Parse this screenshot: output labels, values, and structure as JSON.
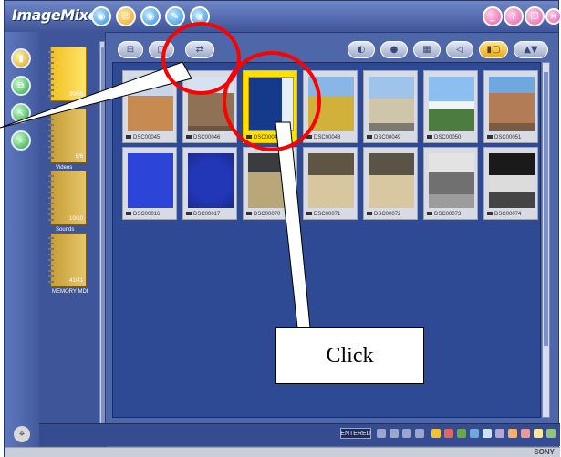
{
  "app": {
    "title": "ImageMixer",
    "title_buttons": [
      {
        "icon": "disc-blue-icon"
      },
      {
        "icon": "person-orange-icon"
      },
      {
        "icon": "disc-blue-icon"
      },
      {
        "icon": "edit-blue-icon"
      },
      {
        "icon": "disc-blue-icon"
      }
    ],
    "window_controls": [
      {
        "icon": "minimize-icon",
        "glyph": "_"
      },
      {
        "icon": "help-icon",
        "glyph": "?"
      },
      {
        "icon": "restore-icon",
        "glyph": "❐"
      },
      {
        "icon": "close-icon",
        "glyph": "✕"
      }
    ]
  },
  "left_buttons": [
    {
      "icon": "album-icon"
    },
    {
      "icon": "copy-icon"
    },
    {
      "icon": "cursor-icon"
    },
    {
      "icon": "search-icon"
    }
  ],
  "albums": [
    {
      "label": "",
      "count": "30/55",
      "selected": true
    },
    {
      "label": "Videos",
      "count": "6/6",
      "selected": false
    },
    {
      "label": "Sounds",
      "count": "10/10",
      "selected": false
    },
    {
      "label": "MEMORY MDI",
      "count": "41/41",
      "selected": false
    }
  ],
  "toolbar_left": [
    {
      "glyph": "⊟"
    },
    {
      "glyph": "▢"
    },
    {
      "glyph": "⇄"
    }
  ],
  "toolbar_right": [
    {
      "glyph": "◐"
    },
    {
      "glyph": "●"
    },
    {
      "glyph": "▦"
    },
    {
      "glyph": "◁"
    },
    {
      "glyph": "▮▢",
      "active": true
    },
    {
      "glyph": "▲▼"
    }
  ],
  "thumbnails": [
    {
      "caption": "DSC00045",
      "scene": "desert"
    },
    {
      "caption": "DSC00046",
      "scene": "ruins"
    },
    {
      "caption": "DSC00047",
      "scene": "door",
      "selected": true
    },
    {
      "caption": "DSC00048",
      "scene": "sunflowers"
    },
    {
      "caption": "DSC00049",
      "scene": "arch"
    },
    {
      "caption": "DSC00050",
      "scene": "mountain"
    },
    {
      "caption": "DSC00051",
      "scene": "cathedral"
    },
    {
      "caption": "DSC00016",
      "scene": "blue-cartoon"
    },
    {
      "caption": "DSC00017",
      "scene": "blue-stars"
    },
    {
      "caption": "DSC00070",
      "scene": "room"
    },
    {
      "caption": "DSC00071",
      "scene": "hall"
    },
    {
      "caption": "DSC00072",
      "scene": "hall"
    },
    {
      "caption": "DSC00073",
      "scene": "screen"
    },
    {
      "caption": "DSC00074",
      "scene": "dark-screen"
    }
  ],
  "status": {
    "mode": "ENTERED",
    "right_label": "SONY"
  },
  "callout": {
    "text": "Click"
  },
  "colors": {
    "frame": "#4d67a9",
    "canvas": "#2f4a95",
    "selection": "#ffe100",
    "annotation": "#ff0000"
  }
}
